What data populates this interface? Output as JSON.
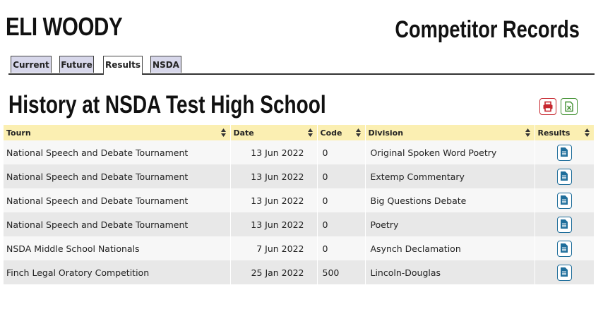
{
  "header": {
    "competitor_name": "ELI WOODY",
    "page_title": "Competitor Records"
  },
  "tabs": [
    {
      "label": "Current",
      "active": false
    },
    {
      "label": "Future",
      "active": false
    },
    {
      "label": "Results",
      "active": true
    },
    {
      "label": "NSDA",
      "active": false
    }
  ],
  "section": {
    "title": "History at NSDA Test High School",
    "print_icon": "printer-icon",
    "excel_icon": "excel-file-icon"
  },
  "table": {
    "columns": [
      "Tourn",
      "Date",
      "Code",
      "Division",
      "Results"
    ],
    "rows": [
      {
        "tourn": "National Speech and Debate Tournament",
        "date": "13 Jun 2022",
        "code": "0",
        "division": "Original Spoken Word Poetry"
      },
      {
        "tourn": "National Speech and Debate Tournament",
        "date": "13 Jun 2022",
        "code": "0",
        "division": "Extemp Commentary"
      },
      {
        "tourn": "National Speech and Debate Tournament",
        "date": "13 Jun 2022",
        "code": "0",
        "division": "Big Questions Debate"
      },
      {
        "tourn": "National Speech and Debate Tournament",
        "date": "13 Jun 2022",
        "code": "0",
        "division": "Poetry"
      },
      {
        "tourn": "NSDA Middle School Nationals",
        "date": "7 Jun 2022",
        "code": "0",
        "division": "Asynch Declamation"
      },
      {
        "tourn": "Finch Legal Oratory Competition",
        "date": "25 Jan 2022",
        "code": "500",
        "division": "Lincoln-Douglas"
      }
    ],
    "results_icon": "document-icon"
  },
  "colors": {
    "header_row": "#fbefb2",
    "tab_bg": "#d7d7ea",
    "print_accent": "#c6262e",
    "excel_accent": "#3f8f2f",
    "results_accent": "#1f6e9b"
  }
}
